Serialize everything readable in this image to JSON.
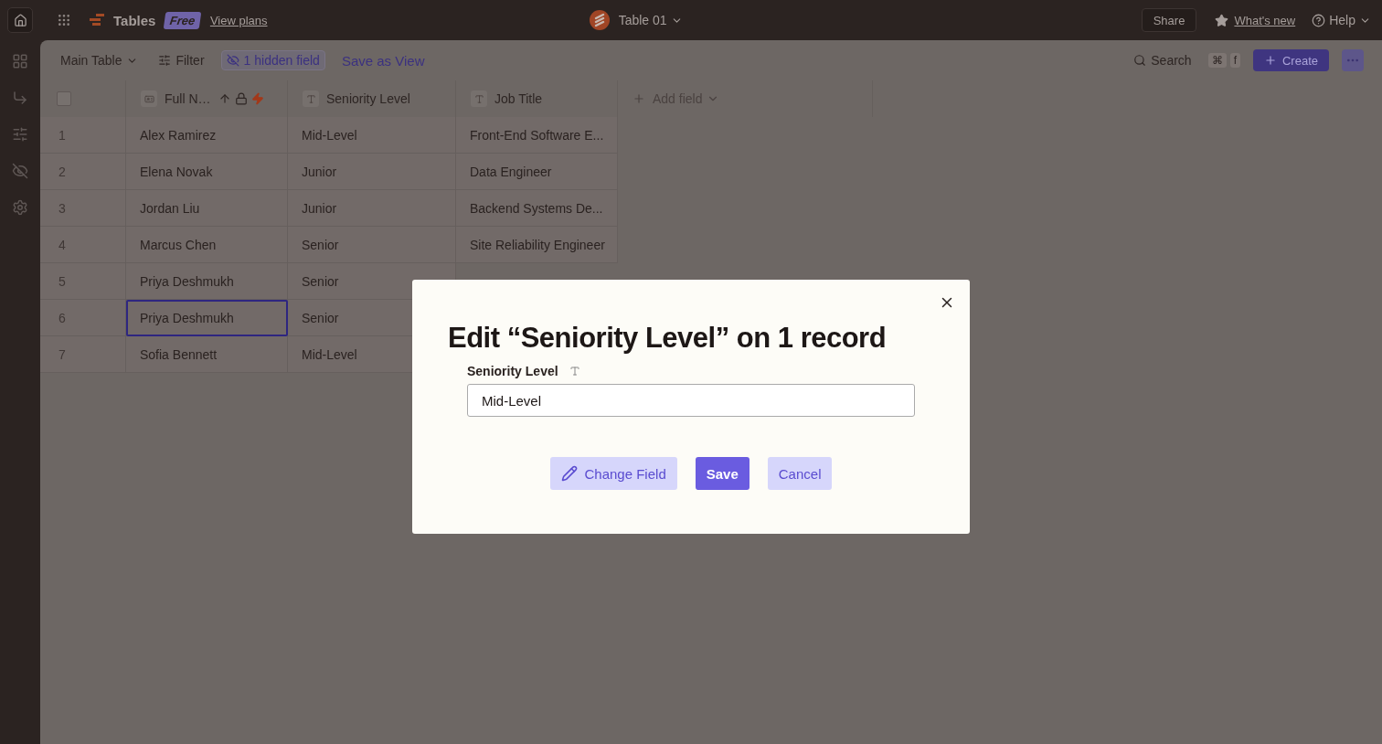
{
  "topbar": {
    "app": "Tables",
    "plan": "Free",
    "plans_link": "View plans",
    "table": "Table 01",
    "share": "Share",
    "whats_new": "What's new",
    "help": "Help"
  },
  "toolbar": {
    "view": "Main Table",
    "filter": "Filter",
    "hidden": "1 hidden field",
    "save_view": "Save as View",
    "search": "Search",
    "shortcut": [
      "⌘",
      "f"
    ],
    "create": "Create"
  },
  "table": {
    "select_all": false,
    "columns": [
      {
        "label": "Full N…",
        "kind": "name"
      },
      {
        "label": "Seniority Level",
        "kind": "text"
      },
      {
        "label": "Job Title",
        "kind": "text"
      }
    ],
    "add_field": "Add field",
    "rows": [
      {
        "n": "1",
        "cells": [
          "Alex Ramirez",
          "Mid-Level",
          "Front-End Software E..."
        ],
        "selected": false
      },
      {
        "n": "2",
        "cells": [
          "Elena Novak",
          "Junior",
          "Data Engineer"
        ],
        "selected": false
      },
      {
        "n": "3",
        "cells": [
          "Jordan Liu",
          "Junior",
          "Backend Systems De..."
        ],
        "selected": false
      },
      {
        "n": "4",
        "cells": [
          "Marcus Chen",
          "Senior",
          "Site Reliability Engineer"
        ],
        "selected": false
      },
      {
        "n": "5",
        "cells": [
          "Priya Deshmukh",
          "Senior"
        ],
        "selected": false
      },
      {
        "n": "6",
        "cells": [
          "Priya Deshmukh",
          "Senior"
        ],
        "selected": true
      },
      {
        "n": "7",
        "cells": [
          "Sofia Bennett",
          "Mid-Level"
        ],
        "selected": false
      }
    ]
  },
  "dialog": {
    "title": "Edit “Seniority Level” on 1 record",
    "field_label": "Seniority Level",
    "value": "Mid-Level",
    "buttons": [
      {
        "label": "Change Field",
        "kind": "edit"
      },
      {
        "label": "Save",
        "kind": "primary"
      },
      {
        "label": "Cancel",
        "kind": "secondary"
      }
    ]
  }
}
